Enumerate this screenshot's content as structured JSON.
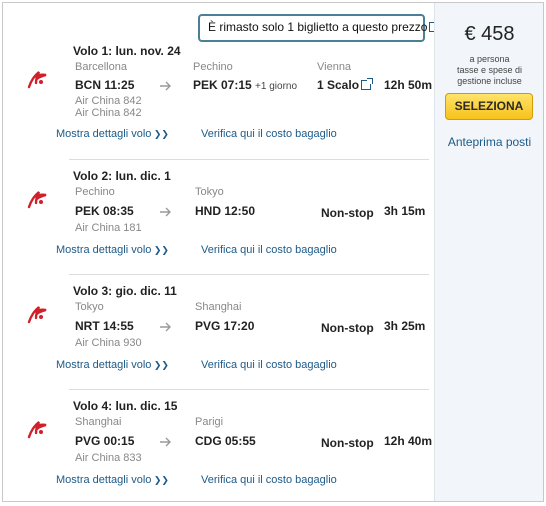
{
  "notice": {
    "text": "È rimasto solo 1 biglietto a questo prezzo"
  },
  "price": {
    "amount": "€ 458",
    "note_line1": "a persona",
    "note_line2": "tasse e spese di",
    "note_line3": "gestione incluse",
    "select_label": "SELEZIONA",
    "preview_label": "Anteprima posti"
  },
  "segments": [
    {
      "title": "Volo  1:  lun. nov. 24",
      "from_city": "Barcellona",
      "from": "BCN  11:25",
      "to_city": "Pechino",
      "to": "PEK  07:15",
      "plus_day": "+1 giorno",
      "via_city": "Vienna",
      "stops": "1 Scalo",
      "duration": "12h 50m",
      "airline1": "Air China 842",
      "airline2": "Air China 842",
      "details_link": "Mostra dettagli volo",
      "baggage_link": "Verifica qui il costo bagaglio"
    },
    {
      "title": "Volo  2:  lun. dic. 1",
      "from_city": "Pechino",
      "from": "PEK  08:35",
      "to_city": "Tokyo",
      "to": "HND  12:50",
      "stops": "Non-stop",
      "duration": "3h 15m",
      "airline1": "Air China 181",
      "details_link": "Mostra dettagli volo",
      "baggage_link": "Verifica qui il costo bagaglio"
    },
    {
      "title": "Volo  3:  gio. dic. 11",
      "from_city": "Tokyo",
      "from": "NRT  14:55",
      "to_city": "Shanghai",
      "to": "PVG  17:20",
      "stops": "Non-stop",
      "duration": "3h 25m",
      "airline1": "Air China 930",
      "details_link": "Mostra dettagli volo",
      "baggage_link": "Verifica qui il costo bagaglio"
    },
    {
      "title": "Volo  4:  lun. dic. 15",
      "from_city": "Shanghai",
      "from": "PVG  00:15",
      "to_city": "Parigi",
      "to": "CDG  05:55",
      "stops": "Non-stop",
      "duration": "12h 40m",
      "airline1": "Air China 833",
      "details_link": "Mostra dettagli volo",
      "baggage_link": "Verifica qui il costo bagaglio"
    }
  ],
  "icons": {
    "airline_logo": "air-china-logo-icon",
    "arrow": "arrow-right-icon",
    "external": "external-link-icon",
    "chevron": "double-chevron-down-icon"
  },
  "colors": {
    "link": "#1d5a88",
    "button": "#f7c21b",
    "logo": "#d0202a",
    "notice_border": "#4a7f96"
  }
}
